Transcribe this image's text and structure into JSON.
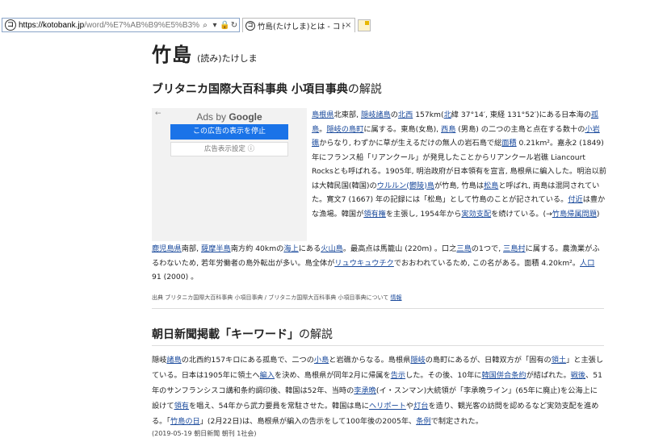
{
  "browser": {
    "url_main": "https://kotobank.jp",
    "url_rest": "/word/%E7%AB%B9%E5%B3%",
    "search_icon": "search-icon",
    "refresh_icon": "refresh-icon",
    "tab_title": "竹島(たけしま)とは - コトバンク",
    "tab_close": "×",
    "site_icon_glyph": "コ"
  },
  "entry": {
    "word": "竹島",
    "reading": "(読み)たけしま"
  },
  "britannica": {
    "heading": "ブリタニカ国際大百科事典 小項目事典",
    "heading_suffix": "の解説",
    "ad": {
      "back": "←",
      "brand_prefix": "Ads by ",
      "brand_name": "Google",
      "stop_button": "この広告の表示を停止",
      "settings_button": "広告表示設定 ⓘ"
    },
    "p1": [
      {
        "t": "島根県",
        "l": true
      },
      {
        "t": "北東部, "
      },
      {
        "t": "隠岐諸島",
        "l": true
      },
      {
        "t": "の"
      },
      {
        "t": "北西",
        "l": true
      },
      {
        "t": " 157km("
      },
      {
        "t": "北",
        "l": true
      },
      {
        "t": "緯 37°14′, 東経 131°52′)にある日本海の"
      },
      {
        "t": "孤島",
        "l": true
      },
      {
        "t": "。"
      },
      {
        "t": "隠岐の島町",
        "l": true
      },
      {
        "t": "に属する。東島(女島), "
      },
      {
        "t": "西島",
        "l": true
      },
      {
        "t": " (男島) の二つの主島と点在する数十の"
      },
      {
        "t": "小岩礁",
        "l": true
      },
      {
        "t": "からなり, わずかに草が生えるだけの無人の岩石島で総"
      },
      {
        "t": "面積",
        "l": true
      },
      {
        "t": " 0.21km²。嘉永2 (1849) 年にフランス船「リアンクール」が発見したことからリアンクール岩礁 Liancourt Rocksとも呼ばれる。1905年, 明治政府が日本領有を宣言, 島根県に編入した。明治以前は大韓民国(韓国)の"
      },
      {
        "t": "ウルルン(鬱陵)島",
        "l": true
      },
      {
        "t": "が竹島, 竹島は"
      },
      {
        "t": "松島",
        "l": true
      },
      {
        "t": "と呼ばれ, 両島は混同されていた。寛文7 (1667) 年の記録には「松島」として竹島のことが記されている。"
      },
      {
        "t": "付近",
        "l": true
      },
      {
        "t": "は豊かな漁場。韓国が"
      },
      {
        "t": "領有権",
        "l": true
      },
      {
        "t": "を主張し, 1954年から"
      },
      {
        "t": "実効支配",
        "l": true
      },
      {
        "t": "を続けている。(→"
      },
      {
        "t": "竹島帰属問題",
        "l": true
      },
      {
        "t": ")"
      }
    ],
    "p2": [
      {
        "t": "鹿児島県",
        "l": true
      },
      {
        "t": "南部, "
      },
      {
        "t": "薩摩半島",
        "l": true
      },
      {
        "t": "南方約 40kmの"
      },
      {
        "t": "海上",
        "l": true
      },
      {
        "t": "にある"
      },
      {
        "t": "火山島",
        "l": true
      },
      {
        "t": "。最高点は馬籠山 (220m) 。口之"
      },
      {
        "t": "三島",
        "l": true
      },
      {
        "t": "の1つで, "
      },
      {
        "t": "三島村",
        "l": true
      },
      {
        "t": "に属する。農漁業がふるわないため, 若年労働者の島外転出が多い。島全体が"
      },
      {
        "t": "リュウキュウチク",
        "l": true
      },
      {
        "t": "でおおわれているため, この名がある。面積 4.20km²。"
      },
      {
        "t": "人口",
        "l": true
      },
      {
        "t": " 91 (2000) 。"
      }
    ],
    "source_prefix": "出典 ブリタニカ国際大百科事典 小項目事典 / ブリタニカ国際大百科事典 小項目事典について",
    "source_link": "情報"
  },
  "asahi": {
    "heading": "朝日新聞掲載「キーワード」",
    "heading_suffix": "の解説",
    "p3": [
      {
        "t": "隠岐"
      },
      {
        "t": "諸島",
        "l": true
      },
      {
        "t": "の北西約157キロにある孤島で、二つの"
      },
      {
        "t": "小島",
        "l": true
      },
      {
        "t": "と岩礁からなる。島根県"
      },
      {
        "t": "隠岐",
        "l": true
      },
      {
        "t": "の島町にあるが、日韓双方が「固有の"
      },
      {
        "t": "領土",
        "l": true
      },
      {
        "t": "」と主張している。日本は1905年に領土へ"
      },
      {
        "t": "編入",
        "l": true
      },
      {
        "t": "を決め、島根県が同年2月に帰属を"
      },
      {
        "t": "告示",
        "l": true
      },
      {
        "t": "した。その後、10年に"
      },
      {
        "t": "韓国併合条約",
        "l": true
      },
      {
        "t": "が結ばれた。"
      },
      {
        "t": "戦後",
        "l": true
      },
      {
        "t": "、51年のサンフランシスコ講和条約調印後、韓国は52年、当時の"
      },
      {
        "t": "李承晩",
        "l": true
      },
      {
        "t": "(イ・スンマン)大統領が「李承晩ライン」(65年に廃止)を公海上に設けて"
      },
      {
        "t": "領有",
        "l": true
      },
      {
        "t": "を唱え、54年から武力要員を常駐させた。韓国は島に"
      },
      {
        "t": "ヘリポート",
        "l": true
      },
      {
        "t": "や"
      },
      {
        "t": "灯台",
        "l": true
      },
      {
        "t": "を造り、観光客の訪問を認めるなど実効支配を進める。「"
      },
      {
        "t": "竹島の日",
        "l": true
      },
      {
        "t": "」(2月22日)は、島根県が編入の告示をして100年後の2005年、"
      },
      {
        "t": "条例",
        "l": true
      },
      {
        "t": "で制定された。"
      }
    ],
    "date": "(2019-05-19 朝日新聞 朝刊 1社会)"
  }
}
